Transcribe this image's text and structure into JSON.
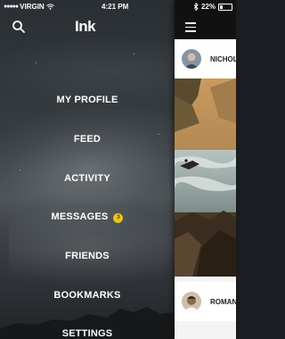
{
  "status_bar": {
    "signal": "●●●●●",
    "carrier": "VIRGIN",
    "time": "4:21 PM",
    "battery": "22%"
  },
  "drawer": {
    "logo": "Ink",
    "items": [
      {
        "label": "MY PROFILE"
      },
      {
        "label": "FEED"
      },
      {
        "label": "ACTIVITY"
      },
      {
        "label": "MESSAGES",
        "badge": "3"
      },
      {
        "label": "FRIENDS"
      },
      {
        "label": "BOOKMARKS"
      },
      {
        "label": "SETTINGS"
      }
    ]
  },
  "feed": {
    "posts": [
      {
        "author": "NICHOL"
      },
      {
        "author": "ROMAN"
      }
    ]
  },
  "colors": {
    "badge": "#f3c400",
    "topbar": "#111111"
  }
}
